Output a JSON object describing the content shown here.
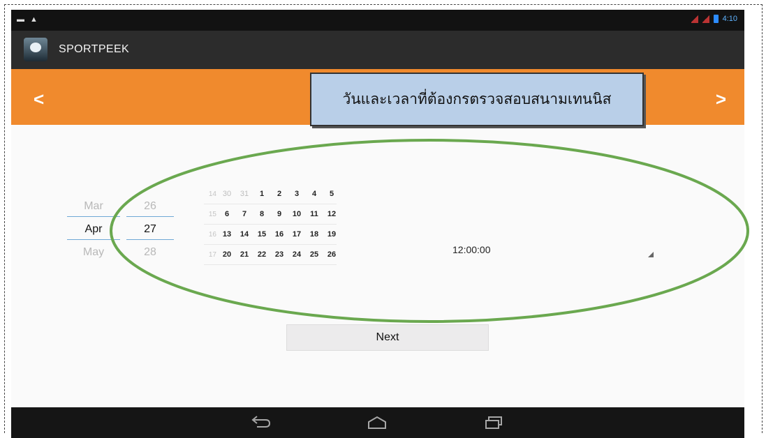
{
  "app": {
    "title": "SPORTPEEK"
  },
  "header": {
    "prev_label": "<",
    "next_label": ">"
  },
  "annotation": {
    "text": "วันและเวลาที่ต้องกรตรวจสอบสนามเทนนิส"
  },
  "date_spinner": {
    "months": [
      "Mar",
      "Apr",
      "May"
    ],
    "days": [
      "26",
      "27",
      "28"
    ]
  },
  "calendar": {
    "rows": [
      {
        "week": "14",
        "days": [
          "30",
          "31",
          "1",
          "2",
          "3",
          "4",
          "5"
        ]
      },
      {
        "week": "15",
        "days": [
          "6",
          "7",
          "8",
          "9",
          "10",
          "11",
          "12"
        ]
      },
      {
        "week": "16",
        "days": [
          "13",
          "14",
          "15",
          "16",
          "17",
          "18",
          "19"
        ]
      },
      {
        "week": "17",
        "days": [
          "20",
          "21",
          "22",
          "23",
          "24",
          "25",
          "26"
        ]
      }
    ]
  },
  "time": {
    "value": "12:00:00"
  },
  "buttons": {
    "next_label": "Next"
  },
  "status_bar": {
    "time": "4:10"
  },
  "icons": [
    "app-icon",
    "back-icon",
    "home-icon",
    "recent-apps-icon",
    "signal-icon",
    "battery-icon",
    "dropdown-icon"
  ],
  "colors": {
    "accent_orange": "#f08a2d",
    "highlight_green": "#6aa84f",
    "callout_blue": "#b9cfe8"
  }
}
